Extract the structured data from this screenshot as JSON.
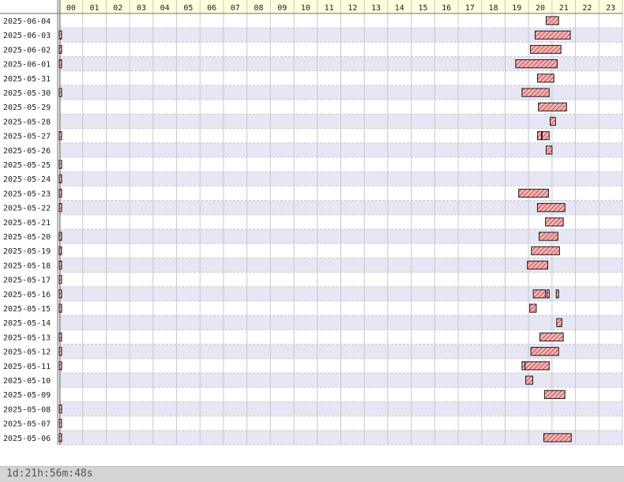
{
  "chart_data": {
    "type": "timeline",
    "hours": [
      "00",
      "01",
      "02",
      "03",
      "04",
      "05",
      "06",
      "07",
      "08",
      "09",
      "10",
      "11",
      "12",
      "13",
      "14",
      "15",
      "16",
      "17",
      "18",
      "19",
      "20",
      "21",
      "22",
      "23"
    ],
    "days": [
      {
        "date": "2025-06-04",
        "segments": [
          [
            20.75,
            21.28
          ]
        ]
      },
      {
        "date": "2025-06-03",
        "segments": [
          [
            0,
            0.02
          ],
          [
            20.28,
            21.78
          ]
        ]
      },
      {
        "date": "2025-06-02",
        "segments": [
          [
            0,
            0.02
          ],
          [
            20.08,
            21.38
          ]
        ]
      },
      {
        "date": "2025-06-01",
        "segments": [
          [
            0,
            0.02
          ],
          [
            19.45,
            21.22
          ]
        ]
      },
      {
        "date": "2025-05-31",
        "segments": [
          [
            20.38,
            21.08
          ]
        ]
      },
      {
        "date": "2025-05-30",
        "segments": [
          [
            0,
            0.02
          ],
          [
            19.72,
            20.88
          ]
        ]
      },
      {
        "date": "2025-05-29",
        "segments": [
          [
            20.42,
            21.62
          ]
        ]
      },
      {
        "date": "2025-05-28",
        "segments": [
          [
            20.92,
            21.15
          ]
        ]
      },
      {
        "date": "2025-05-27",
        "segments": [
          [
            0,
            0.02
          ],
          [
            20.38,
            20.55
          ],
          [
            20.58,
            20.88
          ]
        ]
      },
      {
        "date": "2025-05-26",
        "segments": [
          [
            20.75,
            21.0
          ]
        ]
      },
      {
        "date": "2025-05-25",
        "segments": [
          [
            0,
            0.02
          ]
        ]
      },
      {
        "date": "2025-05-24",
        "segments": [
          [
            0,
            0.02
          ]
        ]
      },
      {
        "date": "2025-05-23",
        "segments": [
          [
            0,
            0.02
          ],
          [
            19.58,
            20.85
          ]
        ]
      },
      {
        "date": "2025-05-22",
        "segments": [
          [
            0,
            0.02
          ],
          [
            20.38,
            21.55
          ]
        ]
      },
      {
        "date": "2025-05-21",
        "segments": [
          [
            20.72,
            21.48
          ]
        ]
      },
      {
        "date": "2025-05-20",
        "segments": [
          [
            0,
            0.02
          ],
          [
            20.45,
            21.25
          ]
        ]
      },
      {
        "date": "2025-05-19",
        "segments": [
          [
            0,
            0.02
          ],
          [
            20.12,
            21.32
          ]
        ]
      },
      {
        "date": "2025-05-18",
        "segments": [
          [
            0,
            0.02
          ],
          [
            19.95,
            20.82
          ]
        ]
      },
      {
        "date": "2025-05-17",
        "segments": [
          [
            0,
            0.02
          ]
        ]
      },
      {
        "date": "2025-05-16",
        "segments": [
          [
            0,
            0.02
          ],
          [
            20.2,
            20.72
          ],
          [
            20.78,
            20.86
          ],
          [
            21.18,
            21.26
          ]
        ]
      },
      {
        "date": "2025-05-15",
        "segments": [
          [
            0,
            0.02
          ],
          [
            20.05,
            20.33
          ]
        ]
      },
      {
        "date": "2025-05-14",
        "segments": [
          [
            21.2,
            21.42
          ]
        ]
      },
      {
        "date": "2025-05-13",
        "segments": [
          [
            0,
            0.02
          ],
          [
            20.48,
            21.48
          ]
        ]
      },
      {
        "date": "2025-05-12",
        "segments": [
          [
            0,
            0.02
          ],
          [
            20.1,
            21.28
          ]
        ]
      },
      {
        "date": "2025-05-11",
        "segments": [
          [
            0,
            0.02
          ],
          [
            19.72,
            19.85
          ],
          [
            19.85,
            20.88
          ]
        ]
      },
      {
        "date": "2025-05-10",
        "segments": [
          [
            19.88,
            20.18
          ]
        ]
      },
      {
        "date": "2025-05-09",
        "segments": [
          [
            20.68,
            21.55
          ]
        ]
      },
      {
        "date": "2025-05-08",
        "segments": [
          [
            0,
            0.02
          ]
        ]
      },
      {
        "date": "2025-05-07",
        "segments": [
          [
            0,
            0.02
          ]
        ]
      },
      {
        "date": "2025-05-06",
        "segments": [
          [
            0,
            0.02
          ],
          [
            20.65,
            21.82
          ]
        ]
      }
    ],
    "colors": {
      "header_bg": "#ffffe0",
      "row_band": "#e6e6f5",
      "grid": "#c8c8c8",
      "bar_fill": "#f0b8b8",
      "bar_hatch": "#c84848",
      "bar_stroke": "#1a1a1a",
      "label_text": "#202020"
    }
  },
  "footer": {
    "total_label": "1d:21h:56m:48s"
  }
}
